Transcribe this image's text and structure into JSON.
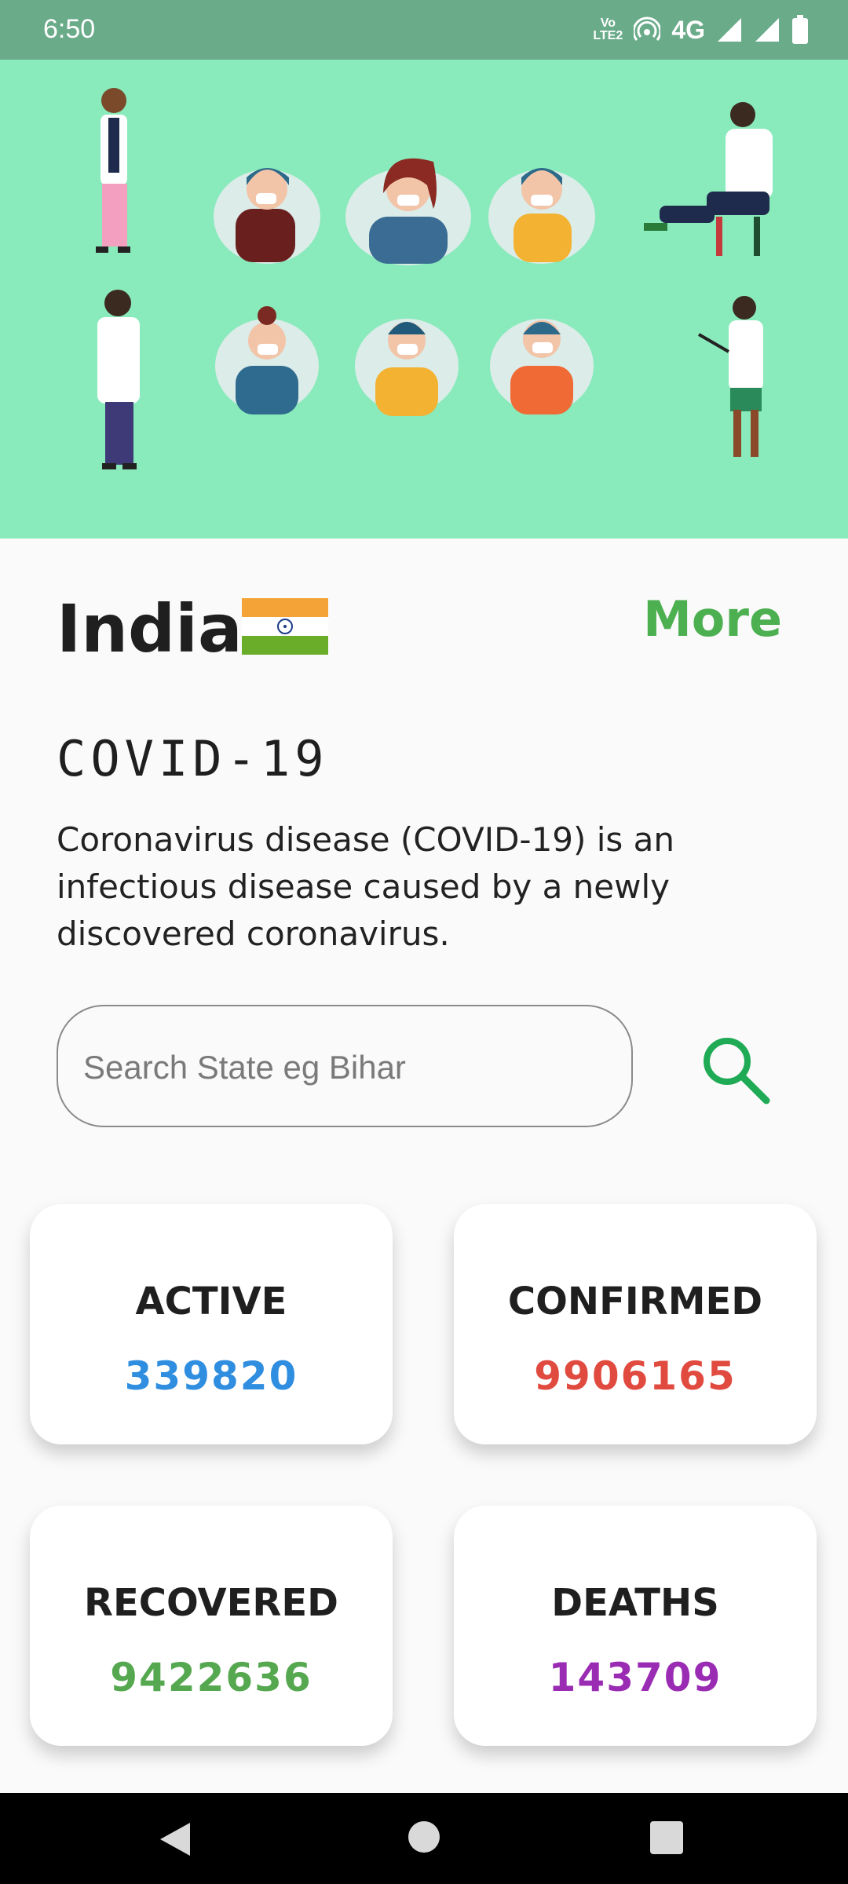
{
  "status_bar": {
    "time": "6:50",
    "volte": "Vo LTE2",
    "network": "4G",
    "icons": [
      "volte-icon",
      "hotspot-icon",
      "network-4g-icon",
      "signal-icon",
      "signal-icon",
      "battery-icon"
    ]
  },
  "header": {
    "country": "India",
    "flag_icon": "india-flag-icon",
    "more_label": "More"
  },
  "section": {
    "title": "COVID-19",
    "description": "Coronavirus disease (COVID-19) is an infectious disease caused by a newly discovered coronavirus."
  },
  "search": {
    "placeholder": "Search State eg Bihar",
    "value": "",
    "icon": "search-icon"
  },
  "stats": [
    {
      "label": "ACTIVE",
      "value": "339820",
      "color": "#2f8ee0"
    },
    {
      "label": "CONFIRMED",
      "value": "9906165",
      "color": "#e04a3f"
    },
    {
      "label": "RECOVERED",
      "value": "9422636",
      "color": "#55a84f"
    },
    {
      "label": "DEATHS",
      "value": "143709",
      "color": "#9a2cb3"
    }
  ],
  "colors": {
    "hero_bg": "#89eabb",
    "status_bar": "#6aab8a",
    "accent": "#4caf50"
  },
  "nav_bar": {
    "icons": [
      "back-icon",
      "home-icon",
      "recents-icon"
    ]
  }
}
